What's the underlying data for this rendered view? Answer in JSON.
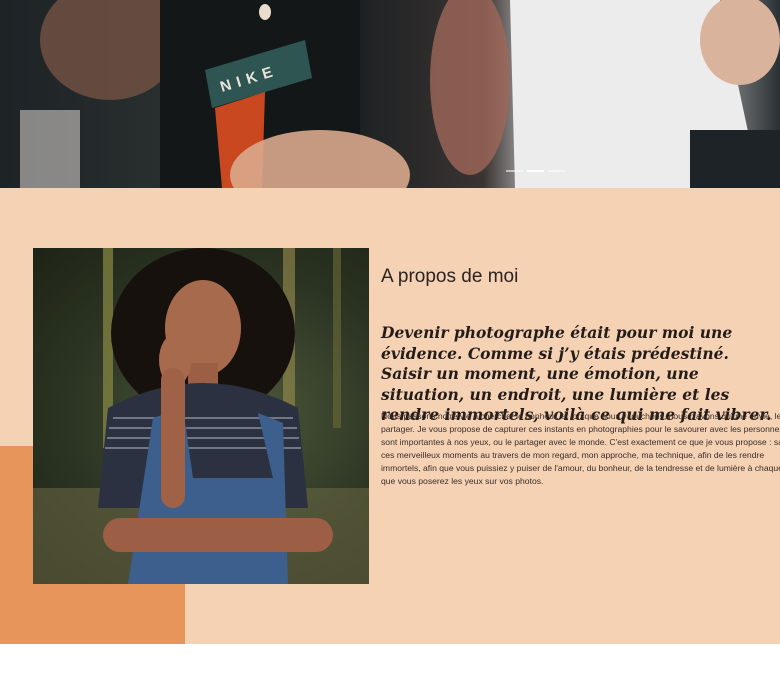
{
  "hero": {
    "shirt_text": "NIKE",
    "slides_total": 3,
    "active_slide": 2
  },
  "about": {
    "title": "A propos de moi",
    "lead": "Devenir photographe était pour moi une évidence. Comme si j’y étais prédestiné. Saisir un moment, une émotion, une situation, un endroit, une lumière et les rendre immortels, voilà ce qui me fait vibrer.",
    "body": "Nous passons notre vie à chercher le bonheur, et lorsque nous y touchons, nous n'avons qu'une envie, le partager. Je vous propose de capturer ces instants en photographies pour le savourer avec les personnes qui sont importantes à nos yeux, ou le partager avec le monde. C'est exactement ce que je vous propose : saisir ces merveilleux moments au travers de mon regard, mon approche, ma technique, afin de les rendre immortels, afin que vous puissiez y puiser de l'amour, du bonheur, de la tendresse et de lumière à chaque fois que vous poserez les yeux sur vos photos."
  },
  "colors": {
    "section_bg": "#f6d2b5",
    "accent": "#e7955a",
    "heading": "#2b2320"
  }
}
